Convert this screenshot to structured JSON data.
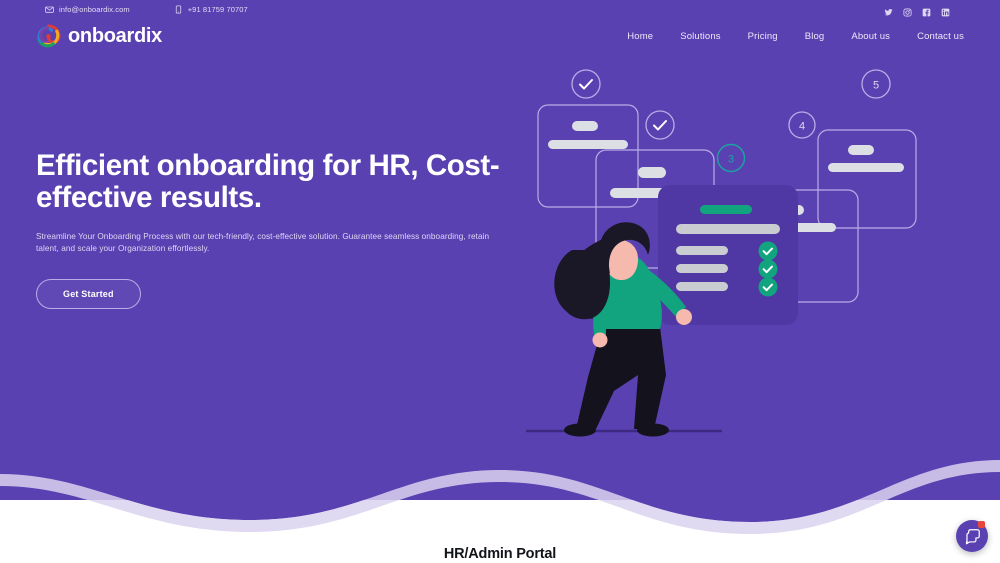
{
  "topbar": {
    "email": "info@onboardix.com",
    "phone": "+91 81759 70707",
    "email_icon": "envelope-icon",
    "phone_icon": "mobile-phone-icon",
    "social": [
      {
        "name": "twitter-icon",
        "label": "Twitter"
      },
      {
        "name": "instagram-icon",
        "label": "Instagram"
      },
      {
        "name": "facebook-icon",
        "label": "Facebook"
      },
      {
        "name": "linkedin-icon",
        "label": "LinkedIn"
      }
    ]
  },
  "brand": {
    "name": "onboardix",
    "logo_icon": "onboardix-swirl-logo"
  },
  "nav": {
    "items": [
      {
        "label": "Home"
      },
      {
        "label": "Solutions"
      },
      {
        "label": "Pricing"
      },
      {
        "label": "Blog"
      },
      {
        "label": "About us"
      },
      {
        "label": "Contact us"
      }
    ]
  },
  "hero": {
    "title": "Efficient onboarding for HR, Cost-effective results.",
    "subtitle": "Streamline Your Onboarding Process with our tech-friendly, cost-effective solution. Guarantee seamless onboarding, retain talent, and scale your Organization effortlessly.",
    "cta_label": "Get Started"
  },
  "illustration": {
    "name": "onboarding-steps-illustration",
    "step_badges": [
      {
        "label": "✓",
        "kind": "check"
      },
      {
        "label": "✓",
        "kind": "check"
      },
      {
        "label": "3",
        "kind": "number"
      },
      {
        "label": "4",
        "kind": "number"
      },
      {
        "label": "5",
        "kind": "number"
      }
    ],
    "checklist_checks": 3
  },
  "section": {
    "title": "HR/Admin Portal"
  },
  "chat_widget": {
    "icon": "chat-bubbles-icon",
    "has_badge": true
  },
  "colors": {
    "purple": "#5a41b2",
    "purple_dark": "#4f38a3",
    "lavender": "#b9aee6",
    "green": "#12a47e",
    "teal": "#1aa6a0",
    "gray_bar": "#c9ccd1",
    "red_badge": "#e8453c",
    "text_dark": "#111418"
  }
}
